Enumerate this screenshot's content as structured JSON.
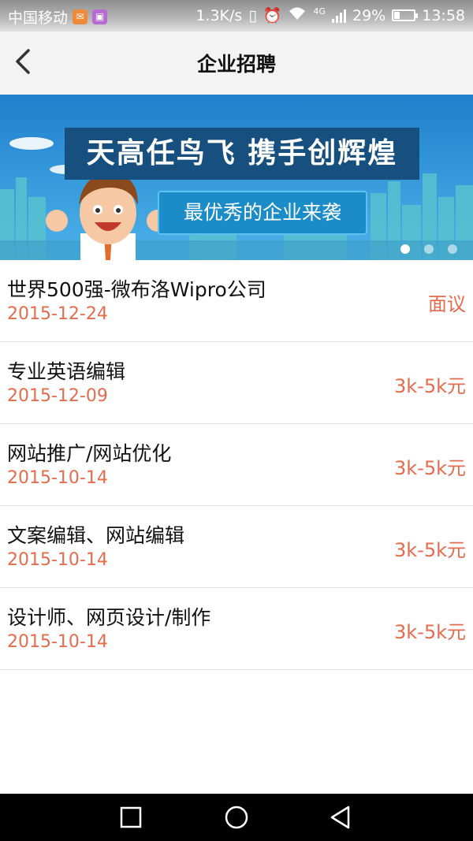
{
  "status_bar": {
    "carrier": "中国移动",
    "speed": "1.3K/s",
    "network": "4G",
    "battery": "29%",
    "battery_level": 0.29,
    "time": "13:58"
  },
  "nav": {
    "title": "企业招聘",
    "back_icon": "chevron-left-icon"
  },
  "banner": {
    "headline": "天高任鸟飞 携手创辉煌",
    "subtitle": "最优秀的企业来袭",
    "slides": 3,
    "active_slide": 0,
    "colors": {
      "sky": "#2a8fd6",
      "headline_bg": "#174f7e"
    }
  },
  "jobs": [
    {
      "title": "世界500强-微布洛Wipro公司",
      "date": "2015-12-24",
      "salary": "面议"
    },
    {
      "title": "专业英语编辑",
      "date": "2015-12-09",
      "salary": "3k-5k元"
    },
    {
      "title": "网站推广/网站优化",
      "date": "2015-10-14",
      "salary": "3k-5k元"
    },
    {
      "title": "文案编辑、网站编辑",
      "date": "2015-10-14",
      "salary": "3k-5k元"
    },
    {
      "title": "设计师、网页设计/制作",
      "date": "2015-10-14",
      "salary": "3k-5k元"
    }
  ],
  "colors": {
    "accent": "#e66b4d"
  },
  "system_nav": [
    "square-recents-icon",
    "circle-home-icon",
    "triangle-back-icon"
  ]
}
